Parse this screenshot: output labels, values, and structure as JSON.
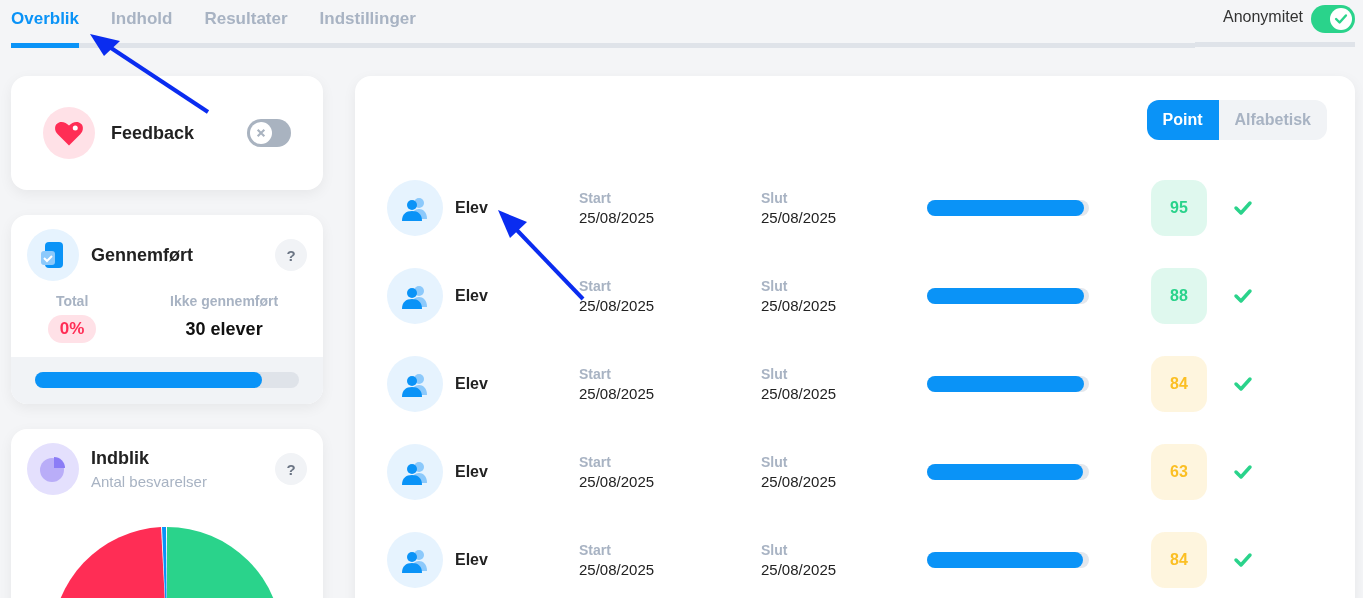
{
  "tabs": [
    {
      "label": "Overblik",
      "selected": true
    },
    {
      "label": "Indhold",
      "selected": false
    },
    {
      "label": "Resultater",
      "selected": false
    },
    {
      "label": "Indstillinger",
      "selected": false
    }
  ],
  "anonymity": {
    "label": "Anonymitet",
    "on": true
  },
  "feedback_card": {
    "title": "Feedback",
    "on": false
  },
  "completed_card": {
    "title": "Gennemført",
    "help": "?",
    "total_label": "Total",
    "total_value": "0%",
    "not_completed_label": "Ikke gennemført",
    "not_completed_value": "30 elever",
    "level": 0.86
  },
  "insight_card": {
    "title": "Indblik",
    "subtitle": "Antal besvarelser",
    "help": "?"
  },
  "sort_options": [
    {
      "label": "Point",
      "selected": true
    },
    {
      "label": "Alfabetisk",
      "selected": false
    }
  ],
  "students": [
    {
      "name": "Elev",
      "start_label": "Start",
      "start": "25/08/2025",
      "end_label": "Slut",
      "end": "25/08/2025",
      "level": 0.97,
      "score": "95",
      "color": "#2ad38b",
      "done": true
    },
    {
      "name": "Elev",
      "start_label": "Start",
      "start": "25/08/2025",
      "end_label": "Slut",
      "end": "25/08/2025",
      "level": 0.97,
      "score": "88",
      "color": "#2ad38b",
      "done": true
    },
    {
      "name": "Elev",
      "start_label": "Start",
      "start": "25/08/2025",
      "end_label": "Slut",
      "end": "25/08/2025",
      "level": 0.97,
      "score": "84",
      "color": "#fbbf24",
      "done": true
    },
    {
      "name": "Elev",
      "start_label": "Start",
      "start": "25/08/2025",
      "end_label": "Slut",
      "end": "25/08/2025",
      "level": 0.96,
      "score": "63",
      "color": "#fbbf24",
      "done": true
    },
    {
      "name": "Elev",
      "start_label": "Start",
      "start": "25/08/2025",
      "end_label": "Slut",
      "end": "25/08/2025",
      "level": 0.96,
      "score": "84",
      "color": "#fbbf24",
      "done": true
    }
  ]
}
